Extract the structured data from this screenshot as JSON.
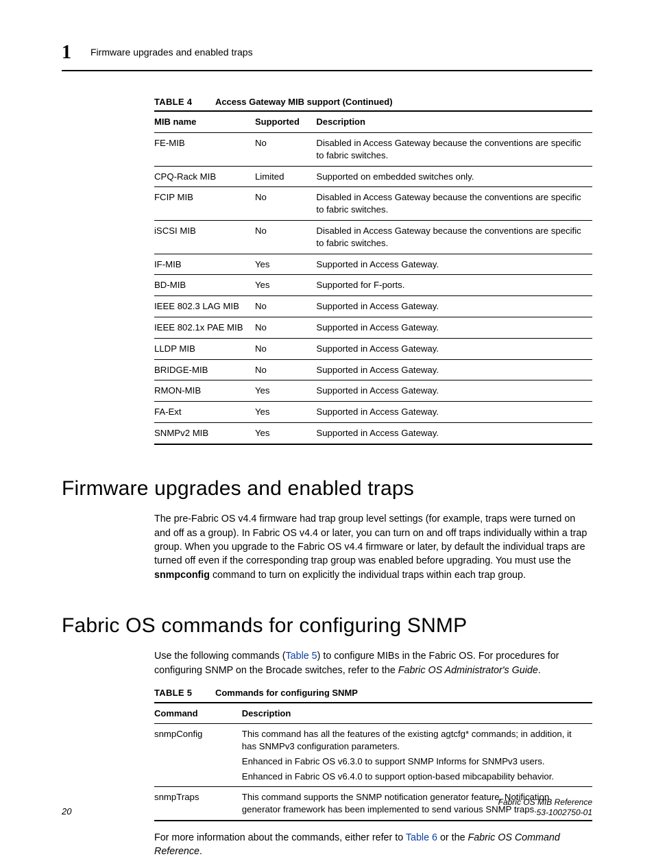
{
  "header": {
    "chapter_number": "1",
    "running_title": "Firmware upgrades and enabled traps"
  },
  "table4": {
    "label": "TABLE 4",
    "title": "Access Gateway MIB support (Continued)",
    "columns": [
      "MIB name",
      "Supported",
      "Description"
    ],
    "rows": [
      {
        "mib": "FE-MIB",
        "supported": "No",
        "desc": "Disabled in Access Gateway because the conventions are specific to fabric switches."
      },
      {
        "mib": "CPQ-Rack MIB",
        "supported": "Limited",
        "desc": "Supported on embedded switches only."
      },
      {
        "mib": "FCIP MIB",
        "supported": "No",
        "desc": "Disabled in Access Gateway because the conventions are specific to fabric switches."
      },
      {
        "mib": "iSCSI MIB",
        "supported": "No",
        "desc": "Disabled in Access Gateway because the conventions are specific to fabric switches."
      },
      {
        "mib": "IF-MIB",
        "supported": "Yes",
        "desc": "Supported in Access Gateway."
      },
      {
        "mib": "BD-MIB",
        "supported": "Yes",
        "desc": "Supported for F-ports."
      },
      {
        "mib": "IEEE 802.3 LAG MIB",
        "supported": "No",
        "desc": "Supported in Access Gateway."
      },
      {
        "mib": "IEEE 802.1x PAE MIB",
        "supported": "No",
        "desc": "Supported in Access Gateway."
      },
      {
        "mib": "LLDP MIB",
        "supported": "No",
        "desc": "Supported in Access Gateway."
      },
      {
        "mib": "BRIDGE-MIB",
        "supported": "No",
        "desc": "Supported in Access Gateway."
      },
      {
        "mib": "RMON-MIB",
        "supported": "Yes",
        "desc": "Supported in Access Gateway."
      },
      {
        "mib": "FA-Ext",
        "supported": "Yes",
        "desc": "Supported in Access Gateway."
      },
      {
        "mib": "SNMPv2 MIB",
        "supported": "Yes",
        "desc": "Supported in Access Gateway."
      }
    ]
  },
  "section1": {
    "heading": "Firmware upgrades and enabled traps",
    "para_parts": {
      "p1a": "The pre-Fabric OS v4.4 firmware had trap group level settings (for example, traps were turned on and off as a group). In Fabric OS v4.4 or later, you can turn on and off traps individually within a trap group. When you upgrade to the Fabric OS v4.4 firmware or later, by default the individual traps are turned off even if the corresponding trap group was enabled before upgrading. You must use the ",
      "cmd": "snmpconfig",
      "p1b": " command to turn on explicitly the individual traps within each trap group."
    }
  },
  "section2": {
    "heading": "Fabric OS commands for configuring SNMP",
    "intro": {
      "a": "Use the following commands (",
      "link": "Table 5",
      "b": ") to configure MIBs in the Fabric OS. For procedures for configuring SNMP on the Brocade switches, refer to the ",
      "ital": "Fabric OS Administrator's Guide",
      "c": "."
    }
  },
  "table5": {
    "label": "TABLE 5",
    "title": "Commands for configuring SNMP",
    "columns": [
      "Command",
      "Description"
    ],
    "rows": [
      {
        "cmd": "snmpConfig",
        "desc": [
          "This command has all the features of the existing agtcfg* commands; in addition, it has SNMPv3 configuration parameters.",
          "Enhanced in Fabric OS v6.3.0 to support SNMP Informs for SNMPv3 users.",
          "Enhanced in Fabric OS v6.4.0 to support option-based mibcapability behavior."
        ]
      },
      {
        "cmd": "snmpTraps",
        "desc": [
          "This command supports the SNMP notification generator feature, Notification generator framework has been implemented to send various SNMP traps."
        ]
      }
    ]
  },
  "closing": {
    "a": "For more information about the commands, either refer to ",
    "link": "Table 6",
    "b": " or the ",
    "ital": "Fabric OS Command Reference",
    "c": "."
  },
  "footer": {
    "page": "20",
    "doc_title": "Fabric OS MIB Reference",
    "doc_id": "53-1002750-01"
  }
}
